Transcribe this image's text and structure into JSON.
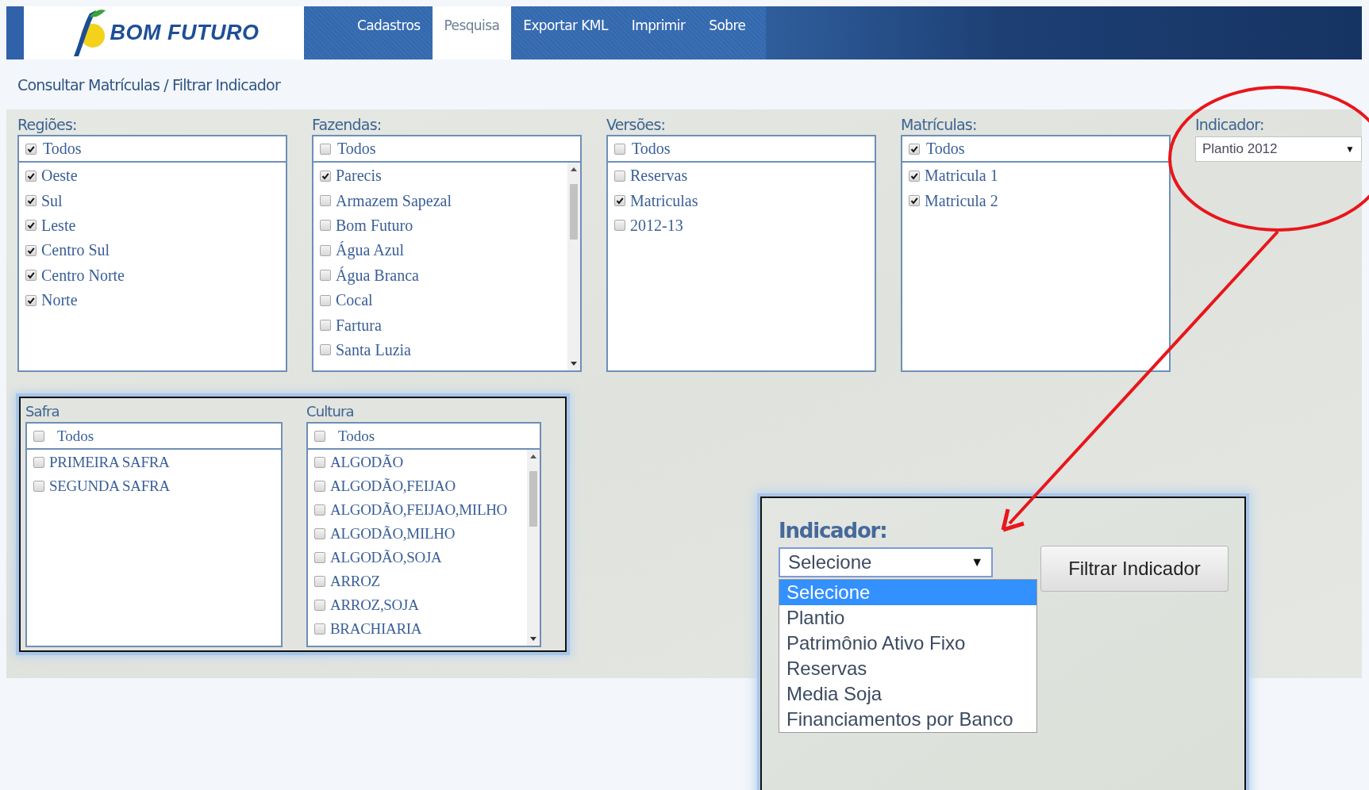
{
  "header": {
    "logo": "BOM FUTURO",
    "nav": [
      {
        "label": "Cadastros",
        "selected": false
      },
      {
        "label": "Pesquisa",
        "selected": true
      },
      {
        "label": "Exportar KML",
        "selected": false
      },
      {
        "label": "Imprimir",
        "selected": false
      },
      {
        "label": "Sobre",
        "selected": false
      }
    ]
  },
  "breadcrumb": "Consultar Matrículas / Filtrar Indicador",
  "filters": [
    {
      "label": "Regiões:",
      "all": {
        "label": "Todos",
        "checked": true
      },
      "scrollbar": false,
      "items": [
        {
          "label": "Oeste",
          "checked": true
        },
        {
          "label": "Sul",
          "checked": true
        },
        {
          "label": "Leste",
          "checked": true
        },
        {
          "label": "Centro Sul",
          "checked": true
        },
        {
          "label": "Centro Norte",
          "checked": true
        },
        {
          "label": "Norte",
          "checked": true
        }
      ]
    },
    {
      "label": "Fazendas:",
      "all": {
        "label": "Todos",
        "checked": false
      },
      "scrollbar": true,
      "items": [
        {
          "label": "Parecis",
          "checked": true
        },
        {
          "label": "Armazem Sapezal",
          "checked": false
        },
        {
          "label": "Bom Futuro",
          "checked": false
        },
        {
          "label": "Água Azul",
          "checked": false
        },
        {
          "label": "Água Branca",
          "checked": false
        },
        {
          "label": "Cocal",
          "checked": false
        },
        {
          "label": "Fartura",
          "checked": false
        },
        {
          "label": "Santa Luzia",
          "checked": false
        }
      ]
    },
    {
      "label": "Versões:",
      "all": {
        "label": "Todos",
        "checked": false
      },
      "scrollbar": false,
      "items": [
        {
          "label": "Reservas",
          "checked": false
        },
        {
          "label": "Matriculas",
          "checked": true
        },
        {
          "label": "2012-13",
          "checked": false
        }
      ]
    },
    {
      "label": "Matrículas:",
      "all": {
        "label": "Todos",
        "checked": true
      },
      "scrollbar": false,
      "items": [
        {
          "label": "Matricula 1",
          "checked": true
        },
        {
          "label": "Matricula 2",
          "checked": true
        }
      ]
    }
  ],
  "indicator": {
    "label": "Indicador:",
    "value": "Plantio 2012"
  },
  "crop_filters": [
    {
      "label": "Safra",
      "all": {
        "label": "Todos",
        "checked": false
      },
      "scrollbar": false,
      "items": [
        {
          "label": "PRIMEIRA SAFRA",
          "checked": false
        },
        {
          "label": "SEGUNDA SAFRA",
          "checked": false
        }
      ]
    },
    {
      "label": "Cultura",
      "all": {
        "label": "Todos",
        "checked": false
      },
      "scrollbar": true,
      "items": [
        {
          "label": "ALGODÃO",
          "checked": false
        },
        {
          "label": "ALGODÃO,FEIJAO",
          "checked": false
        },
        {
          "label": "ALGODÃO,FEIJAO,MILHO",
          "checked": false
        },
        {
          "label": "ALGODÃO,MILHO",
          "checked": false
        },
        {
          "label": "ALGODÃO,SOJA",
          "checked": false
        },
        {
          "label": "ARROZ",
          "checked": false
        },
        {
          "label": "ARROZ,SOJA",
          "checked": false
        },
        {
          "label": "BRACHIARIA",
          "checked": false
        }
      ]
    }
  ],
  "callout": {
    "label": "Indicador:",
    "value": "Selecione",
    "caret": "▼",
    "button": "Filtrar Indicador",
    "options": [
      {
        "label": "Selecione",
        "selected": true
      },
      {
        "label": "Plantio",
        "selected": false
      },
      {
        "label": "Patrimônio Ativo Fixo",
        "selected": false
      },
      {
        "label": "Reservas",
        "selected": false
      },
      {
        "label": "Media Soja",
        "selected": false
      },
      {
        "label": "Financiamentos por Banco",
        "selected": false
      }
    ]
  }
}
